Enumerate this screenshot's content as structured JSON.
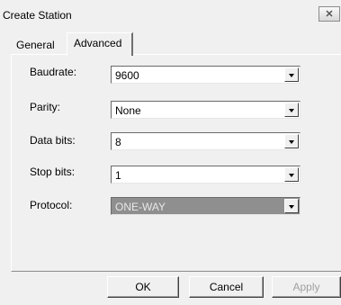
{
  "window": {
    "title": "Create Station",
    "close_glyph": "✕"
  },
  "tabs": [
    {
      "label": "General",
      "active": false
    },
    {
      "label": "Advanced",
      "active": true
    }
  ],
  "fields": {
    "baudrate": {
      "label": "Baudrate:",
      "value": "9600"
    },
    "parity": {
      "label": "Parity:",
      "value": "None"
    },
    "data_bits": {
      "label": "Data bits:",
      "value": "8"
    },
    "stop_bits": {
      "label": "Stop bits:",
      "value": "1"
    },
    "protocol": {
      "label": "Protocol:",
      "value": "ONE-WAY",
      "disabled": true
    }
  },
  "buttons": {
    "ok": "OK",
    "cancel": "Cancel",
    "apply": "Apply"
  },
  "icons": {
    "close": "close-icon",
    "dropdown": "chevron-down-icon"
  },
  "colors": {
    "dialog_bg": "#f0f0f0",
    "disabled_combo_bg": "#8f8f8f",
    "disabled_text": "#a0a0a0"
  }
}
